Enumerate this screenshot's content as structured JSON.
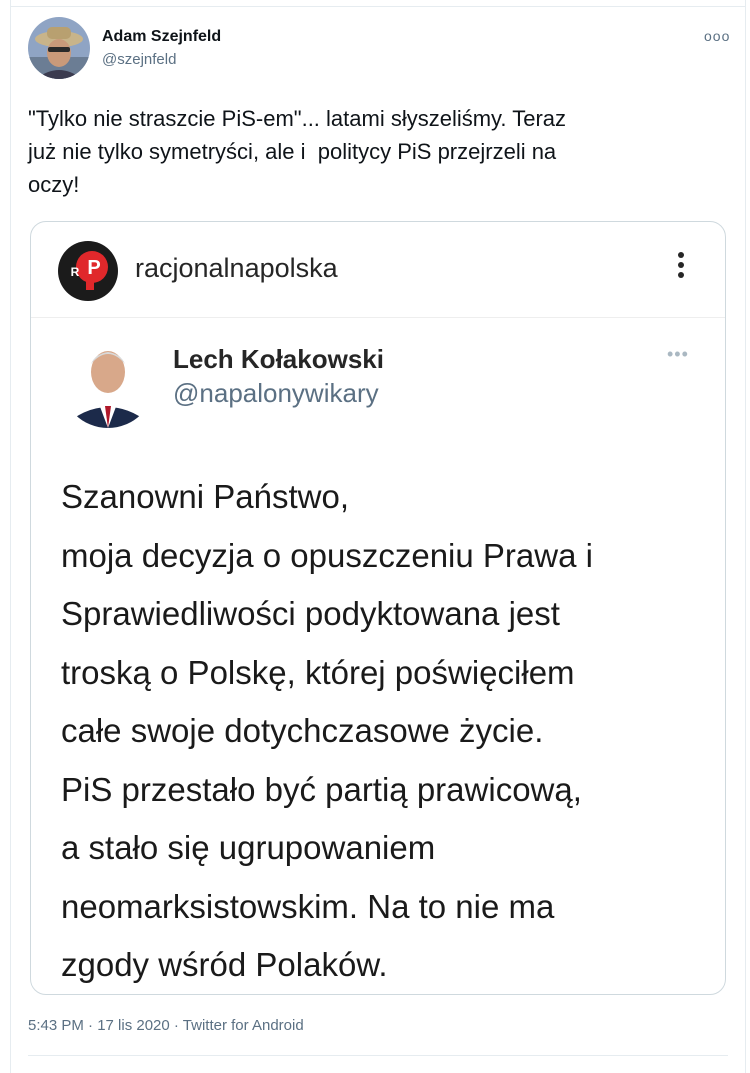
{
  "tweet": {
    "author_name": "Adam Szejnfeld",
    "author_handle": "@szejnfeld",
    "more_icon": "more-horizontal-icon",
    "text": "\"Tylko nie straszcie PiS-em\"... latami słyszeliśmy. Teraz\njuż nie tylko symetryści, ale i  politycy PiS przejrzeli na\noczy!",
    "footer": "5:43 PM · 17 lis 2020 · Twitter for Android"
  },
  "embed": {
    "account_name": "racjonalnapolska",
    "menu_icon": "kebab-menu-icon",
    "logo_letters": "RP",
    "quoted": {
      "name": "Lech Kołakowski",
      "handle": "@napalonywikary",
      "text": "Szanowni Państwo,\nmoja decyzja o opuszczeniu Prawa i\nSprawiedliwości podyktowana jest\ntroską o Polskę, której poświęciłem\ncałe swoje dotychczasowe życie.\nPiS przestało być partią prawicową,\na stało się ugrupowaniem\nneomarksistowskim. Na to nie ma\nzgody wśród Polaków."
    }
  },
  "colors": {
    "text_primary": "#0f1419",
    "text_secondary": "#5b7083",
    "border": "#cfd9de",
    "logo_red": "#e0282b"
  }
}
